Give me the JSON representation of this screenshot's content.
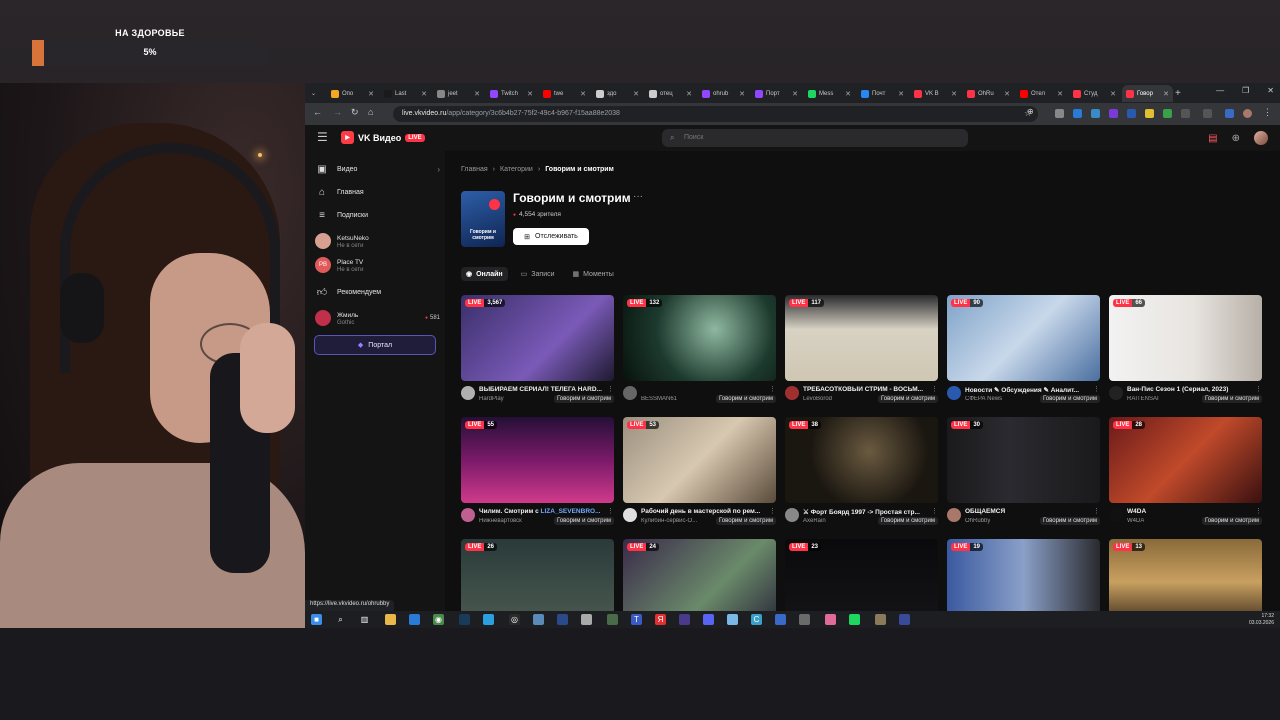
{
  "goal": {
    "title": "НА ЗДОРОВЬЕ",
    "percent_label": "5%",
    "progress": 0.05
  },
  "browser": {
    "tabs": [
      {
        "label": "Опо",
        "color": "#f5a623"
      },
      {
        "label": "Last",
        "color": "#1a1a1a"
      },
      {
        "label": "jeet",
        "color": "#888888"
      },
      {
        "label": "Twitch",
        "color": "#9146ff"
      },
      {
        "label": "twe",
        "color": "#ff0000"
      },
      {
        "label": "здо",
        "color": "#cccccc"
      },
      {
        "label": "отец",
        "color": "#cccccc"
      },
      {
        "label": "ohrub",
        "color": "#9146ff"
      },
      {
        "label": "Порт",
        "color": "#9146ff"
      },
      {
        "label": "Mess",
        "color": "#1ed760"
      },
      {
        "label": "Почт",
        "color": "#2787f5"
      },
      {
        "label": "VK В",
        "color": "#ff3347"
      },
      {
        "label": "OhRu",
        "color": "#ff3347"
      },
      {
        "label": "Отел",
        "color": "#ff0000"
      },
      {
        "label": "Студ",
        "color": "#ff3347"
      },
      {
        "label": "Говор",
        "color": "#ff3347",
        "active": true
      }
    ],
    "url_host": "live.vkvideo.ru",
    "url_path": "/app/category/3c6b4b27-75f2-49c4-b967-f15aa88e2038",
    "status_url": "https://live.vkvideo.ru/ohrubby"
  },
  "vk": {
    "logo_text": "VK Видео",
    "logo_badge": "LIVE",
    "search_placeholder": "Поиск",
    "sidebar": {
      "nav": [
        {
          "label": "Видео",
          "icon": "play-square-icon",
          "chevron": "›"
        },
        {
          "label": "Главная",
          "icon": "home-icon"
        },
        {
          "label": "Подписки",
          "icon": "subscriptions-icon"
        }
      ],
      "channels": [
        {
          "name": "KetsuNeko",
          "status": "Не в сети",
          "color": "#d8a090"
        },
        {
          "name": "Place TV",
          "status": "Не в сети",
          "initials": "PB",
          "color": "#e05a5a"
        }
      ],
      "recommend_label": "Рекомендуем",
      "recommended": [
        {
          "name": "Жмиль",
          "status": "Gothic",
          "count": "581",
          "color": "#c0304a"
        }
      ],
      "portal_label": "Портал"
    },
    "breadcrumb": [
      "Главная",
      "Категории",
      "Говорим и смотрим"
    ],
    "category": {
      "title": "Говорим и смотрим",
      "cover_caption": "Говорим и смотрим",
      "viewers": "4,554 зрителя",
      "follow_label": "Отслеживать",
      "more": "···"
    },
    "subtabs": [
      {
        "label": "Онлайн",
        "active": true
      },
      {
        "label": "Записи"
      },
      {
        "label": "Моменты"
      }
    ],
    "live_label": "LIVE",
    "streams": [
      {
        "viewers": "3,567",
        "title": "ВЫБИРАЕМ СЕРИАЛ! ТЕЛЕГА HARD...",
        "channel": "HardPlay",
        "category": "Говорим и смотрим",
        "thumb": "linear-gradient(135deg,#3a2f6a,#7a5ab8 60%,#1e1a30)",
        "av": "#b0b0b0"
      },
      {
        "viewers": "132",
        "title": "",
        "channel": "BESSMAN61",
        "category": "Говорим и смотрим",
        "thumb": "radial-gradient(circle at 60% 40%,#8fb8a0,#1d3a2e 55%,#07120c)",
        "av": "#666666"
      },
      {
        "viewers": "117",
        "title": "ТРЕБАСОТКОВЫЙ СТРИМ - ВОСЬМ...",
        "channel": "LevoBorod",
        "category": "Говорим и смотрим",
        "thumb": "linear-gradient(180deg,#2a2a2e,#d8d2c4 40%,#cfc7b2)",
        "av": "#a03030"
      },
      {
        "viewers": "90",
        "title": "Новости ✎ Обсуждения ✎ Аналит...",
        "channel": "СФЕРА News",
        "category": "Говорим и смотрим",
        "thumb": "linear-gradient(135deg,#7fa3c8,#c8d8ea 50%,#4a6fa0)",
        "av": "#2a5ab0"
      },
      {
        "viewers": "66",
        "title": "Ван-Пис Сезон 1 (Сериал, 2023)",
        "channel": "RAITENSAI",
        "category": "Говорим и смотрим",
        "thumb": "linear-gradient(90deg,#f2f2f2,#e8e4e0 55%,#b8b0a8)",
        "av": "#222222"
      },
      {
        "viewers": "55",
        "title": "Чилим. Смотрим с ",
        "highlight": "LIZA_SEVENBRO...",
        "channel": "Нижневартовск",
        "category": "Говорим и смотрим",
        "thumb": "linear-gradient(180deg,#241036,#7a1a6a 50%,#d03a8a)",
        "av": "#c06090"
      },
      {
        "viewers": "53",
        "title": "Рабочий день в мастерской по рем...",
        "channel": "Кулибин-сервис-О...",
        "category": "Говорим и смотрим",
        "thumb": "linear-gradient(135deg,#9a9080,#d8c8b0 50%,#5a4a3a)",
        "av": "#e0e0e0"
      },
      {
        "viewers": "38",
        "title": "⚔ Форт Боярд 1997 -> Простая стр...",
        "channel": "AxeRain",
        "category": "Говорим и смотрим",
        "thumb": "radial-gradient(circle at 55% 40%,#6a5a40,#1a1610 60%)",
        "av": "#888888"
      },
      {
        "viewers": "30",
        "title": "ОБЩАЕМСЯ",
        "channel": "OhRubby",
        "category": "Говорим и смотрим",
        "thumb": "linear-gradient(90deg,#1a1a1c,#2a2a30 40%,#1a1a1c)",
        "av": "#a87868"
      },
      {
        "viewers": "28",
        "title": "W4DA",
        "channel": "W4DA",
        "category": "Говорим и смотрим",
        "thumb": "linear-gradient(135deg,#6a1a1a,#c04a2a 50%,#3a1010)",
        "av": "#111111"
      },
      {
        "viewers": "26",
        "title": "",
        "channel": "",
        "category": "",
        "thumb": "linear-gradient(180deg,#2a3a3a,#4a5a50)",
        "av": ""
      },
      {
        "viewers": "24",
        "title": "",
        "channel": "",
        "category": "",
        "thumb": "linear-gradient(135deg,#3a2a4a,#6a8a6a 60%,#2a2a3a)",
        "av": ""
      },
      {
        "viewers": "23",
        "title": "",
        "channel": "",
        "category": "",
        "thumb": "linear-gradient(180deg,#0a0a0c,#141418)",
        "av": ""
      },
      {
        "viewers": "19",
        "title": "",
        "channel": "",
        "category": "",
        "thumb": "linear-gradient(90deg,#3a5aa0,#8aa0c8 50%,#2a2a2e)",
        "av": ""
      },
      {
        "viewers": "13",
        "title": "",
        "channel": "",
        "category": "",
        "thumb": "linear-gradient(180deg,#8a6a3a,#c8a060 50%,#3a2a1a)",
        "av": ""
      }
    ]
  },
  "taskbar": {
    "time": "17:32",
    "date": "03.03.2026",
    "apps": [
      {
        "icon": "windows-icon",
        "color": "#3a8ee6",
        "glyph": "■"
      },
      {
        "icon": "search-icon",
        "color": "transparent",
        "glyph": "⌕"
      },
      {
        "icon": "task-view-icon",
        "color": "transparent",
        "glyph": "▥"
      },
      {
        "icon": "explorer-icon",
        "color": "#e8b84a",
        "glyph": ""
      },
      {
        "icon": "mail-icon",
        "color": "#2a7ad8",
        "glyph": ""
      },
      {
        "icon": "chrome-icon",
        "color": "#4a8a4a",
        "glyph": "◉"
      },
      {
        "icon": "steam-icon",
        "color": "#1a3a5a",
        "glyph": ""
      },
      {
        "icon": "telegram-icon",
        "color": "#2aa0e0",
        "glyph": ""
      },
      {
        "icon": "obs-icon",
        "color": "#2a2a2a",
        "glyph": "◎"
      },
      {
        "icon": "app-icon",
        "color": "#5a8ab8",
        "glyph": ""
      },
      {
        "icon": "lc-icon",
        "color": "#2a4a8a",
        "glyph": ""
      },
      {
        "icon": "cloud-icon",
        "color": "#aaaaaa",
        "glyph": ""
      },
      {
        "icon": "app2-icon",
        "color": "#4a6a4a",
        "glyph": ""
      },
      {
        "icon": "t-icon",
        "color": "#3a5ac8",
        "glyph": "T"
      },
      {
        "icon": "yandex-icon",
        "color": "#e03030",
        "glyph": "Я"
      },
      {
        "icon": "app3-icon",
        "color": "#4a3a8a",
        "glyph": ""
      },
      {
        "icon": "discord-icon",
        "color": "#5865f2",
        "glyph": ""
      },
      {
        "icon": "app4-icon",
        "color": "#7ab8e8",
        "glyph": ""
      },
      {
        "icon": "c-icon",
        "color": "#3aa0c8",
        "glyph": "C"
      },
      {
        "icon": "stats-icon",
        "color": "#3a6ac8",
        "glyph": ""
      },
      {
        "icon": "app5-icon",
        "color": "#6a6a6a",
        "glyph": ""
      },
      {
        "icon": "photos-icon",
        "color": "#e06a9a",
        "glyph": ""
      },
      {
        "icon": "spotify-icon",
        "color": "#1ed760",
        "glyph": ""
      },
      {
        "icon": "app6-icon",
        "color": "#8a7a5a",
        "glyph": ""
      },
      {
        "icon": "media-icon",
        "color": "#3a4a9a",
        "glyph": ""
      }
    ]
  }
}
